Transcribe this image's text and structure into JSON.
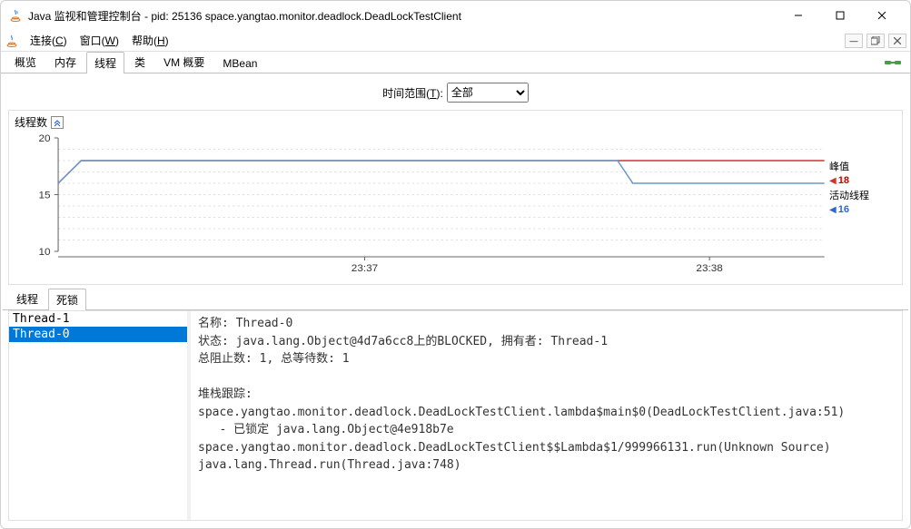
{
  "window": {
    "title": "Java 监视和管理控制台 - pid: 25136 space.yangtao.monitor.deadlock.DeadLockTestClient"
  },
  "menu": {
    "connect": "连接(C)",
    "window": "窗口(W)",
    "help": "帮助(H)"
  },
  "tabs": {
    "overview": "概览",
    "memory": "内存",
    "threads": "线程",
    "classes": "类",
    "vm": "VM 概要",
    "mbean": "MBean",
    "active": "threads"
  },
  "timerange": {
    "label": "时间范围(T):",
    "selected": "全部"
  },
  "chart": {
    "title": "线程数",
    "legend_peak_label": "峰值",
    "legend_peak_value": "18",
    "legend_live_label": "活动线程",
    "legend_live_value": "16"
  },
  "chart_data": {
    "type": "line",
    "title": "线程数",
    "xlabel": "",
    "ylabel": "",
    "ylim": [
      10,
      20
    ],
    "x_ticks": [
      "23:37",
      "23:38"
    ],
    "y_ticks": [
      10,
      15,
      20
    ],
    "series": [
      {
        "name": "峰值",
        "color": "#cc3333",
        "points": [
          [
            0,
            16
          ],
          [
            3,
            18
          ],
          [
            100,
            18
          ]
        ]
      },
      {
        "name": "活动线程",
        "color": "#6699cc",
        "points": [
          [
            0,
            16
          ],
          [
            3,
            18
          ],
          [
            73,
            18
          ],
          [
            75,
            16
          ],
          [
            100,
            16
          ]
        ]
      }
    ]
  },
  "lower_tabs": {
    "threads": "线程",
    "deadlock": "死锁",
    "active": "deadlock"
  },
  "deadlock": {
    "threads": [
      "Thread-1",
      "Thread-0"
    ],
    "selected": "Thread-0",
    "detail_lines": [
      "名称: Thread-0",
      "状态: java.lang.Object@4d7a6cc8上的BLOCKED, 拥有者: Thread-1",
      "总阻止数: 1, 总等待数: 1",
      "",
      "堆栈跟踪: ",
      "space.yangtao.monitor.deadlock.DeadLockTestClient.lambda$main$0(DeadLockTestClient.java:51)",
      "   - 已锁定 java.lang.Object@4e918b7e",
      "space.yangtao.monitor.deadlock.DeadLockTestClient$$Lambda$1/999966131.run(Unknown Source)",
      "java.lang.Thread.run(Thread.java:748)"
    ]
  }
}
